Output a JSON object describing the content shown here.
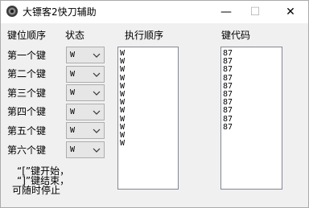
{
  "window": {
    "title": "大镖客2快刀辅助",
    "controls": {
      "minimize": "—",
      "maximize": "☐",
      "close": "✕"
    }
  },
  "headers": {
    "key_position": "键位顺序",
    "state": "状态",
    "exec_order": "执行顺序",
    "key_code": "键代码"
  },
  "rows": [
    {
      "label": "第一个键",
      "value": "W"
    },
    {
      "label": "第二个键",
      "value": "W"
    },
    {
      "label": "第三个键",
      "value": "W"
    },
    {
      "label": "第四个键",
      "value": "W"
    },
    {
      "label": "第五个键",
      "value": "W"
    },
    {
      "label": "第六个键",
      "value": "W"
    }
  ],
  "exec_list": [
    "W",
    "W",
    "W",
    "W",
    "W",
    "W",
    "W",
    "W",
    "W",
    "W",
    "W",
    "W"
  ],
  "code_list": [
    "87",
    "87",
    "87",
    "87",
    "87",
    "87",
    "87",
    "87",
    "87",
    "87"
  ],
  "note": {
    "line1": "“[”键开始，",
    "line2": "“]”键结束，",
    "line3": "可随时停止"
  }
}
